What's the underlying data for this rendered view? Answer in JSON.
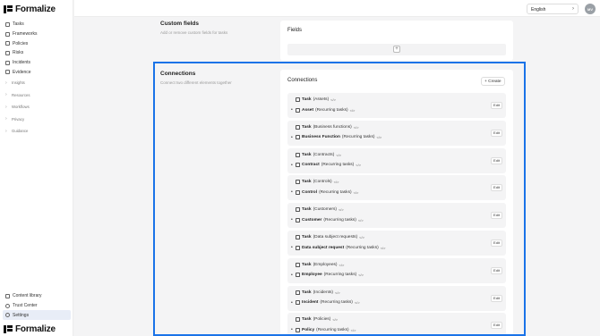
{
  "app": {
    "name": "Formalize"
  },
  "nav": {
    "items": [
      {
        "label": "Tasks",
        "icon": "checkbox-icon"
      },
      {
        "label": "Frameworks",
        "icon": "book-icon"
      },
      {
        "label": "Policies",
        "icon": "shield-icon"
      },
      {
        "label": "Risks",
        "icon": "warning-icon"
      },
      {
        "label": "Incidents",
        "icon": "alert-icon"
      },
      {
        "label": "Evidence",
        "icon": "document-icon"
      }
    ],
    "sections": [
      "Insights",
      "Resources",
      "Workflows",
      "Privacy",
      "Guidance"
    ],
    "bottom": [
      {
        "label": "Content library",
        "icon": "library-icon"
      },
      {
        "label": "Trust Center",
        "icon": "globe-icon"
      },
      {
        "label": "Settings",
        "icon": "gear-icon",
        "active": true
      }
    ]
  },
  "header": {
    "language": "English",
    "avatar": "MV"
  },
  "custom_fields": {
    "title": "Custom fields",
    "description": "Add or remove custom fields for tasks",
    "panel_title": "Fields",
    "add_label": "+"
  },
  "connections": {
    "title": "Connections",
    "description": "Connect two different elements together",
    "panel_title": "Connections",
    "create_label": "+ Create",
    "edit_label": "Edit",
    "items": [
      {
        "top": "Task",
        "top_sub": "(Assets)",
        "bottom": "Asset",
        "bottom_sub": "(Recurring tasks)"
      },
      {
        "top": "Task",
        "top_sub": "(Business functions)",
        "bottom": "Business Function",
        "bottom_sub": "(Recurring tasks)"
      },
      {
        "top": "Task",
        "top_sub": "(Contracts)",
        "bottom": "Contract",
        "bottom_sub": "(Recurring tasks)"
      },
      {
        "top": "Task",
        "top_sub": "(Controls)",
        "bottom": "Control",
        "bottom_sub": "(Recurring tasks)"
      },
      {
        "top": "Task",
        "top_sub": "(Customers)",
        "bottom": "Customer",
        "bottom_sub": "(Recurring tasks)"
      },
      {
        "top": "Task",
        "top_sub": "(Data subject requests)",
        "bottom": "Data subject request",
        "bottom_sub": "(Recurring tasks)"
      },
      {
        "top": "Task",
        "top_sub": "(Employees)",
        "bottom": "Employee",
        "bottom_sub": "(Recurring tasks)"
      },
      {
        "top": "Task",
        "top_sub": "(Incidents)",
        "bottom": "Incident",
        "bottom_sub": "(Recurring tasks)"
      },
      {
        "top": "Task",
        "top_sub": "(Policies)",
        "bottom": "Policy",
        "bottom_sub": "(Recurring tasks)"
      }
    ]
  },
  "colors": {
    "highlight": "#1a73e8",
    "active_bg": "#e8edf7"
  }
}
